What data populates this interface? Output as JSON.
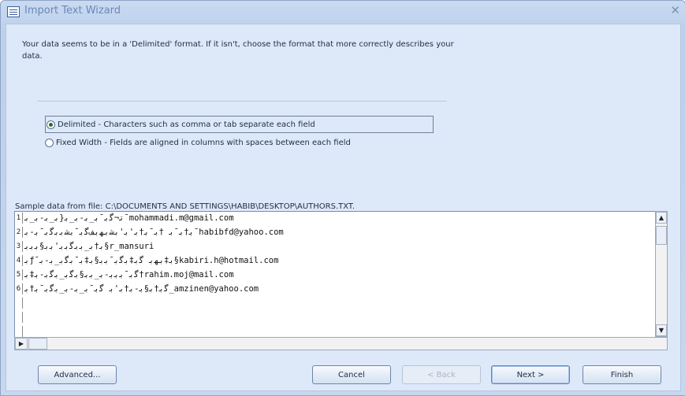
{
  "window": {
    "title": "Import Text Wizard",
    "close_glyph": "✕"
  },
  "intro": {
    "text": "Your data seems to be in a 'Delimited' format. If it isn't, choose the format that more correctly describes your data."
  },
  "format_options": [
    {
      "label": "Delimited - Characters such as comma or tab separate each field",
      "checked": true
    },
    {
      "label": "Fixed Width - Fields are aligned in columns with spaces between each field",
      "checked": false
    }
  ],
  "sample": {
    "label": "Sample data from file: C:\\DOCUMENTS AND SETTINGS\\HABIB\\DESKTOP\\AUTHORS.TXT.",
    "rows": [
      {
        "num": "1",
        "text": "ﺗ¬ﮔﺑ¯ﺑ_ﺑ-ﺑ_ﺑ{ﺑ_ﺑ-ﺑ_ﺑ¯mohammadi.m@gmail.com"
      },
      {
        "num": "2",
        "text": "ﺑ†ﺑ¯ﺑ †ﺑ¯ﺑ†ﺑ'ﺑ'ﺑﺷﺑﻬﺑﻒﮔﺑ¯ﺑﺷﺑﺑﮔﺑ¯ﺑ-ﺑ¯habibfd@yahoo.com"
      },
      {
        "num": "3",
        "text": "ﺑ†ﺑ_ﺑﺑﮔﺑﺑ'ﺑﺑ§ﺑﺑﺑ§r_mansuri"
      },
      {
        "num": "4",
        "text": "ﺑƒ¯ﺑ‡ﺑﻬﺑ ﮔﺑ‡ﺑﮔﺑ¯ﺑﺑ§ﺑ‡ﺑ¯ﺑﮔﺑ_ﺑ-ﺑ§kabiri.h@hotmail.com"
      },
      {
        "num": "5",
        "text": "ﮔﺑ¯ﺑﺑﺑ-ﺑ_ﺑﺑ§ﺑﮔﺑ_ﺑﮔﺑ-ﺑ‡ﺑ†rahim.moj@mail.com"
      },
      {
        "num": "6",
        "text": "ﮔﺑ†ﺑ§ﺑ-ﺑ†ﺑ'ﺑ ﮔﺑ¯ﺑ_ﺑ-ﺑ_ﺑﮔﺑ¯ﺑ†ﺑ_amzinen@yahoo.com"
      },
      {
        "num": "",
        "text": ""
      },
      {
        "num": "",
        "text": ""
      },
      {
        "num": "",
        "text": ""
      }
    ]
  },
  "buttons": {
    "advanced": "Advanced...",
    "cancel": "Cancel",
    "back": "< Back",
    "next": "Next >",
    "finish": "Finish"
  },
  "icons": {
    "title": "table-icon",
    "scroll_up": "▲",
    "scroll_down": "▼",
    "scroll_left": "◀",
    "scroll_right": "▶"
  }
}
